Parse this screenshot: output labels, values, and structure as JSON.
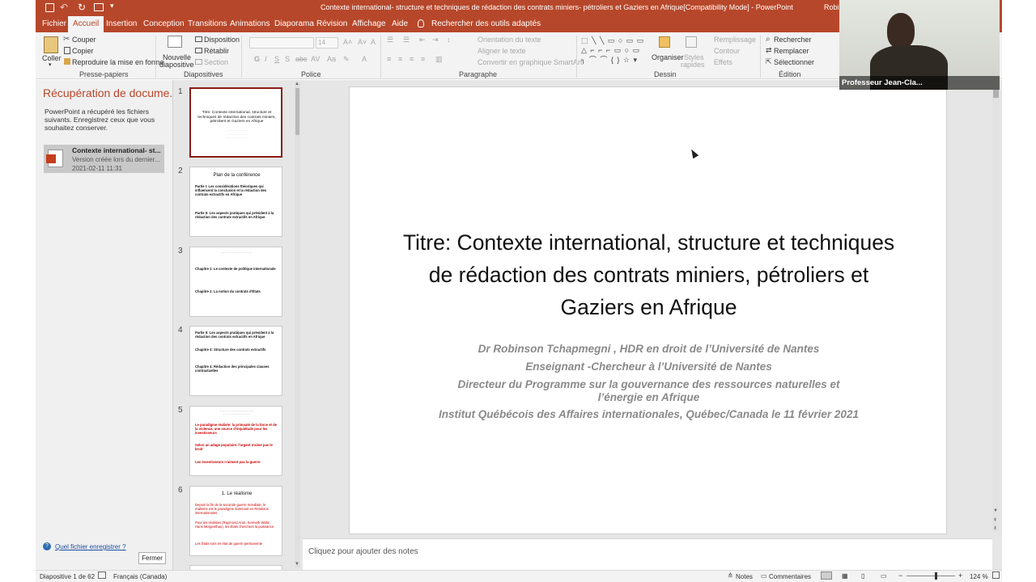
{
  "window": {
    "title": "Contexte international- structure et techniques de rédaction des contrats miniers- pétroliers et Gaziers en Afrique[Compatibility Mode] - PowerPoint",
    "user": "Robin"
  },
  "ribbon_tabs": [
    "Fichier",
    "Accueil",
    "Insertion",
    "Conception",
    "Transitions",
    "Animations",
    "Diaporama",
    "Révision",
    "Affichage",
    "Aide"
  ],
  "tell_me": "Rechercher des outils adaptés",
  "ribbon": {
    "clipboard": {
      "paste": "Coller",
      "cut": "Couper",
      "copy": "Copier",
      "format_painter": "Reproduire la mise en forme",
      "label": "Presse-papiers"
    },
    "slides": {
      "new_slide_1": "Nouvelle",
      "new_slide_2": "diapositive",
      "layout": "Disposition",
      "reset": "Rétablir",
      "section": "Section",
      "label": "Diapositives"
    },
    "font": {
      "size": "14",
      "label": "Police"
    },
    "paragraph": {
      "text_direction": "Orientation du texte",
      "align_text": "Aligner le texte",
      "smartart": "Convertir en graphique SmartArt",
      "label": "Paragraphe"
    },
    "drawing": {
      "arrange": "Organiser",
      "quick_styles_1": "Styles",
      "quick_styles_2": "rapides",
      "fill": "Remplissage",
      "outline": "Contour",
      "effects": "Effets",
      "label": "Dessin"
    },
    "editing": {
      "find": "Rechercher",
      "replace": "Remplacer",
      "select": "Sélectionner",
      "label": "Édition"
    }
  },
  "recovery": {
    "title": "Récupération de docume...",
    "message": "PowerPoint a récupéré les fichiers suivants. Enregistrez ceux que vous souhaitez conserver.",
    "file_name": "Contexte international- st...",
    "file_status": "Version créée lors du dernier...",
    "file_date": "2021-02-11 11:31",
    "help_link": "Quel fichier enregistrer ?",
    "close_button": "Fermer"
  },
  "thumbnails": [
    {
      "num": "1",
      "lines": [
        "Titre: Contexte international, structure et techniques de rédaction des contrats miniers, pétroliers et Gaziers en Afrique"
      ]
    },
    {
      "num": "2",
      "title": "Plan de la conférence",
      "lines": [
        "Partie I: Les considérations théoriques qui influencent la conclusion et la rédaction des contrats extractifs en Afrique",
        "Partie II: Les aspects pratiques qui président à la rédaction des contrats extractifs en Afrique"
      ]
    },
    {
      "num": "3",
      "lines": [
        "Chapitre 1: Le contexte de politique internationale",
        "Chapitre 2: La notion du contrats d'États"
      ]
    },
    {
      "num": "4",
      "lines": [
        "Partie II: Les aspects pratiques qui président à la rédaction des contrats extractifs en Afrique",
        "Chapitre 3: Structure des contrats extractifs",
        "Chapitre 4: Rédaction des principales clauses contractuelles"
      ]
    },
    {
      "num": "5",
      "lines": [
        "Le paradigme réaliste: la primauté de la force et de la violence, une source d'inquiétude pour les investisseurs",
        "Selon un adage populaire: l'argent n'aime pas le bruit",
        "Les investisseurs n'aiment pas la guerre"
      ]
    },
    {
      "num": "6",
      "title": "1. Le réalisme",
      "lines": [
        "Depuis la fin de la seconde guerre mondiale, le réalisme est le paradigme dominant en Relations internationales",
        "Pour les réalistes (Raymond Aron, Kenneth Waltz, Hans Morgenthau), les États cherchent la puissance",
        "Les États sont en état de guerre permanente"
      ]
    }
  ],
  "slide": {
    "title": "Titre: Contexte international, structure et techniques de rédaction des contrats miniers, pétroliers et Gaziers en Afrique",
    "line1": "Dr Robinson Tchapmegni , HDR en droit de l’Université de Nantes",
    "line2": "Enseignant -Chercheur à l’Université de Nantes",
    "line3": "Directeur du Programme sur la gouvernance des ressources naturelles et l’énergie en Afrique",
    "line4": "Institut Québécois des Affaires internationales, Québec/Canada le 11 février 2021"
  },
  "notes_placeholder": "Cliquez pour ajouter des notes",
  "status": {
    "slide_counter": "Diapositive 1 de 62",
    "language": "Français (Canada)",
    "notes": "Notes",
    "comments": "Commentaires",
    "zoom": "124 %",
    "zoom_level": 0.6
  },
  "webcam": {
    "name": "Professeur Jean-Cla..."
  }
}
